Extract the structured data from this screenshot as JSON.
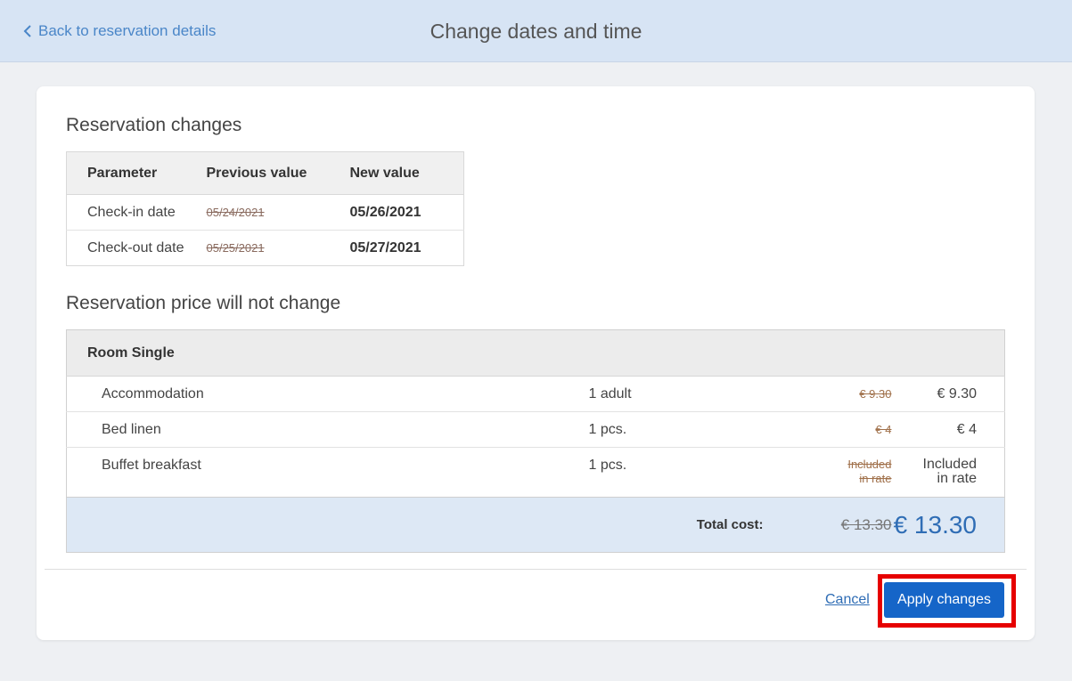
{
  "header": {
    "back_label": "Back to reservation details",
    "title": "Change dates and time"
  },
  "changes": {
    "title": "Reservation changes",
    "columns": [
      "Parameter",
      "Previous value",
      "New value"
    ],
    "rows": [
      {
        "parameter": "Check-in date",
        "previous": "05/24/2021",
        "new": "05/26/2021"
      },
      {
        "parameter": "Check-out date",
        "previous": "05/25/2021",
        "new": "05/27/2021"
      }
    ]
  },
  "price": {
    "title": "Reservation price will not change",
    "room": "Room Single",
    "items": [
      {
        "name": "Accommodation",
        "qty": "1 adult",
        "old": "€ 9.30",
        "new": "€ 9.30"
      },
      {
        "name": "Bed linen",
        "qty": "1 pcs.",
        "old": "€ 4",
        "new": "€ 4"
      },
      {
        "name": "Buffet breakfast",
        "qty": "1 pcs.",
        "old_line1": "Included",
        "old_line2": "in rate",
        "new_line1": "Included",
        "new_line2": "in rate"
      }
    ],
    "total_label": "Total cost:",
    "total_old": "€ 13.30",
    "total_new": "€ 13.30"
  },
  "actions": {
    "cancel_label": "Cancel",
    "apply_label": "Apply changes"
  },
  "colors": {
    "accent": "#1565c8",
    "header_bg": "#d7e4f4",
    "highlight": "#e60000"
  }
}
